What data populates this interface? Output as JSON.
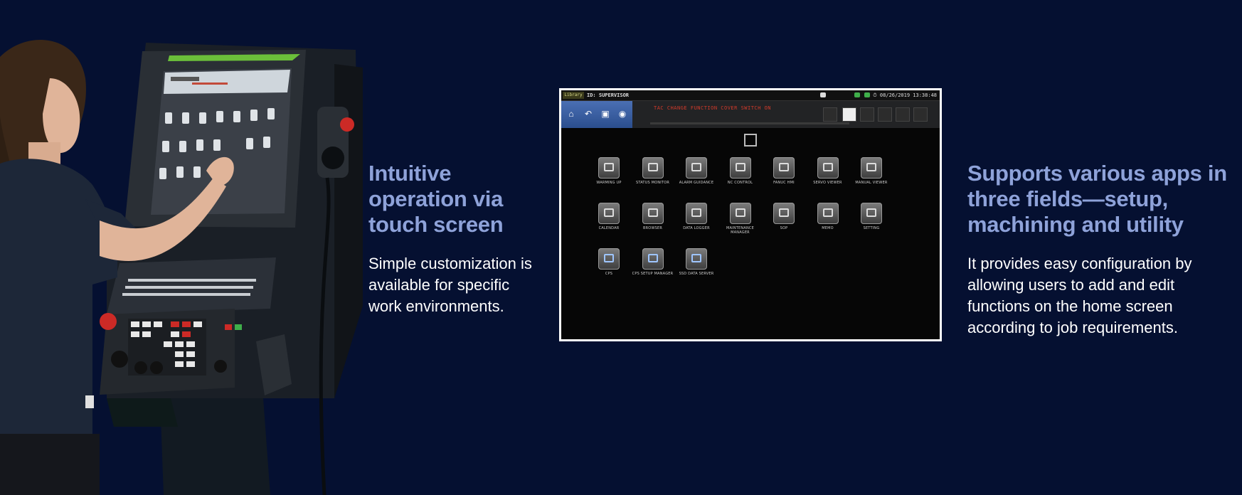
{
  "feature_left": {
    "title": "Intuitive operation  via touch screen",
    "body": "Simple customization is available for specific work environments."
  },
  "feature_right": {
    "title": "Supports various apps in three fields—setup, machining and utility",
    "body": "It provides easy configuration by allowing users to add and edit functions on the home screen according to job requirements."
  },
  "hmi": {
    "mode_tag": "Library",
    "user": "ID: SUPERVISOR",
    "datetime": "08/26/2019 13:38:48",
    "alarm_text": "TAC  CHANGE  FUNCTION  COVER  SWITCH ON",
    "toolbar_icons": [
      "home-icon",
      "undo-icon",
      "lock-icon",
      "camera-icon"
    ],
    "apps": [
      {
        "label": "WARMING UP"
      },
      {
        "label": "STATUS MONITOR"
      },
      {
        "label": "ALARM GUIDANCE"
      },
      {
        "label": "NC CONTROL"
      },
      {
        "label": "FANUC HMI"
      },
      {
        "label": "SERVO VIEWER"
      },
      {
        "label": "MANUAL VIEWER"
      },
      {
        "label": "CALENDAR"
      },
      {
        "label": "BROWSER"
      },
      {
        "label": "DATA LOGGER"
      },
      {
        "label": "MAINTENANCE MANAGER"
      },
      {
        "label": "SOP"
      },
      {
        "label": "MEMO"
      },
      {
        "label": "SETTING"
      },
      {
        "label": "CPS"
      },
      {
        "label": "CPS SETUP MANAGER"
      },
      {
        "label": "SSD DATA SERVER"
      }
    ]
  },
  "colors": {
    "background": "#051031",
    "heading": "#8ea2d9",
    "body_text": "#ffffff"
  }
}
